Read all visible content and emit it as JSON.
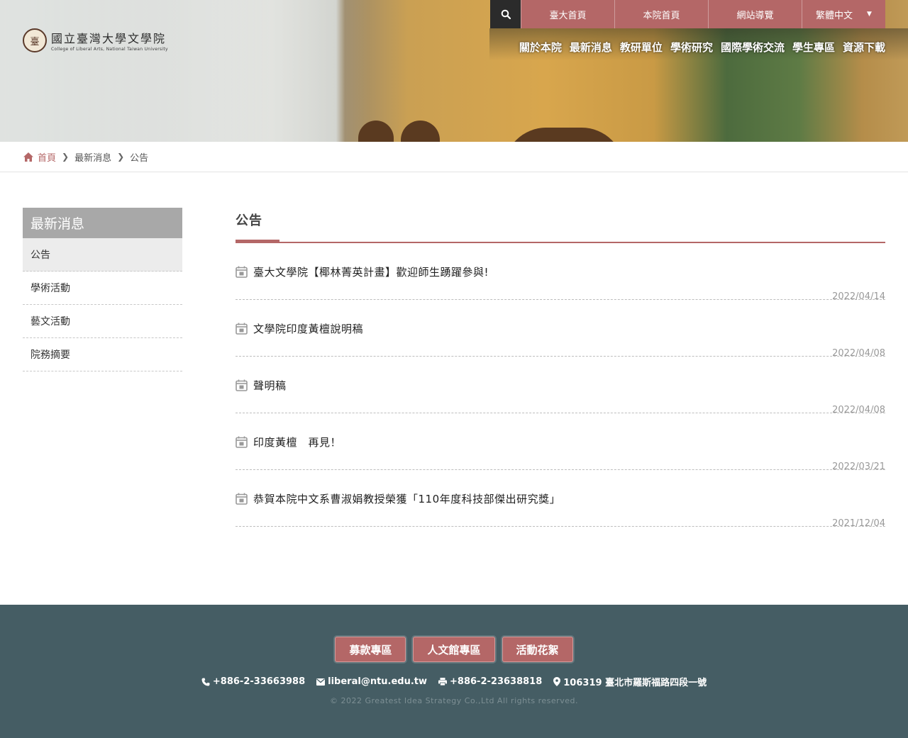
{
  "header": {
    "logo_text_zh": "國立臺灣大學文學院",
    "logo_text_en": "College of Liberal Arts, National Taiwan University",
    "top_links": [
      "臺大首頁",
      "本院首頁",
      "網站導覽"
    ],
    "language": "繁體中文",
    "main_nav": [
      "關於本院",
      "最新消息",
      "教研單位",
      "學術研究",
      "國際學術交流",
      "學生專區",
      "資源下載"
    ]
  },
  "breadcrumb": {
    "home": "首頁",
    "level1": "最新消息",
    "level2": "公告"
  },
  "sidebar": {
    "title": "最新消息",
    "items": [
      "公告",
      "學術活動",
      "藝文活動",
      "院務摘要"
    ]
  },
  "main": {
    "title": "公告",
    "news": [
      {
        "title": "臺大文學院【椰林菁英計畫】歡迎師生踴躍參與!",
        "date": "2022/04/14"
      },
      {
        "title": "文學院印度黃檀說明稿",
        "date": "2022/04/08"
      },
      {
        "title": "聲明稿",
        "date": "2022/04/08"
      },
      {
        "title": "印度黃檀　再見！",
        "date": "2022/03/21"
      },
      {
        "title": "恭賀本院中文系曹淑娟教授榮獲「110年度科技部傑出研究獎」",
        "date": "2021/12/04"
      }
    ]
  },
  "footer": {
    "buttons": [
      "募款專區",
      "人文館專區",
      "活動花絮"
    ],
    "phone": "+886-2-33663988",
    "email": "liberal@ntu.edu.tw",
    "fax": "+886-2-23638818",
    "address": "106319 臺北市羅斯福路四段一號",
    "copyright": "© 2022 Greatest Idea Strategy Co.,Ltd All rights reserved."
  },
  "colors": {
    "accent": "#b46767",
    "footer_bg": "#455d64",
    "sidebar_title_bg": "#a8a8a8"
  }
}
